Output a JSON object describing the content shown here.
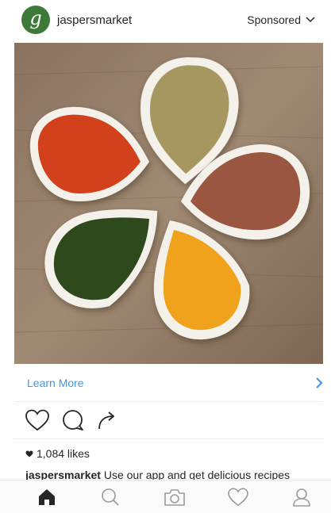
{
  "post": {
    "username": "jaspersmarket",
    "avatar_letter": "g",
    "sponsored_label": "Sponsored",
    "cta_label": "Learn More",
    "likes_label": "1,084 likes",
    "caption_user": "jaspersmarket",
    "caption_text": " Use our app and get delicious recipes"
  },
  "colors": {
    "accent": "#3897f0",
    "avatar": "#3d7a3a"
  },
  "icons": {
    "header": [
      "avatar-logo",
      "chevron-down-icon"
    ],
    "actions": [
      "heart-icon",
      "comment-icon",
      "share-icon"
    ],
    "tabs": [
      "home-icon",
      "search-icon",
      "camera-icon",
      "activity-heart-icon",
      "profile-icon"
    ]
  }
}
